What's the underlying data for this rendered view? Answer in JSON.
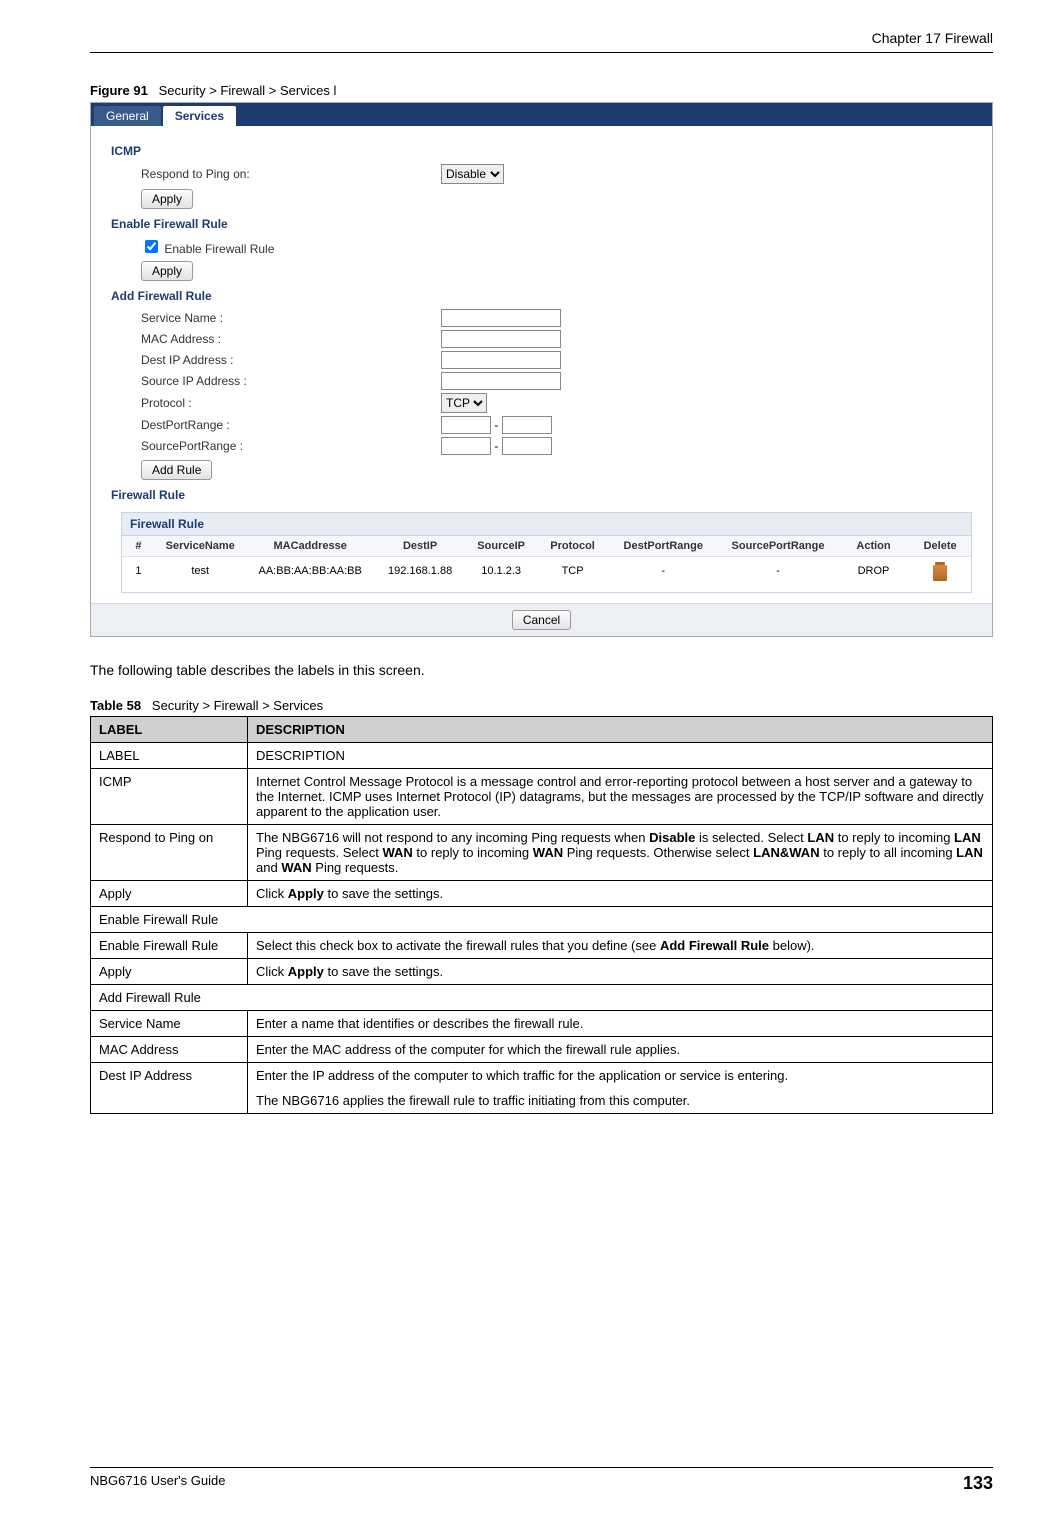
{
  "header": {
    "chapter": "Chapter 17 Firewall"
  },
  "figure": {
    "num": "Figure 91",
    "caption": "Security > Firewall > Services l"
  },
  "tabs": {
    "general": "General",
    "services": "Services"
  },
  "sections": {
    "icmp": "ICMP",
    "respond_label": "Respond to Ping on:",
    "respond_value": "Disable",
    "apply": "Apply",
    "enable_fw_rule": "Enable Firewall Rule",
    "enable_fw_rule_cb": "Enable Firewall Rule",
    "add_fw_rule": "Add Firewall Rule",
    "service_name": "Service Name :",
    "mac_address": "MAC Address :",
    "dest_ip": "Dest IP Address :",
    "source_ip": "Source IP Address :",
    "protocol": "Protocol :",
    "protocol_value": "TCP",
    "dest_port": "DestPortRange :",
    "src_port": "SourcePortRange :",
    "add_rule_btn": "Add Rule",
    "firewall_rule": "Firewall Rule",
    "fr_box_title": "Firewall Rule",
    "cancel": "Cancel"
  },
  "fr_headers": [
    "#",
    "ServiceName",
    "MACaddresse",
    "DestIP",
    "SourceIP",
    "Protocol",
    "DestPortRange",
    "SourcePortRange",
    "Action",
    "Delete"
  ],
  "fr_row": [
    "1",
    "test",
    "AA:BB:AA:BB:AA:BB",
    "192.168.1.88",
    "10.1.2.3",
    "TCP",
    "-",
    "-",
    "DROP",
    ""
  ],
  "intro": "The following table describes the labels in this screen.",
  "table_caption": {
    "num": "Table 58",
    "title": "Security > Firewall > Services"
  },
  "desc_headers": {
    "label": "LABEL",
    "desc": "DESCRIPTION"
  },
  "desc_rows": [
    {
      "label": "LABEL",
      "desc": "DESCRIPTION"
    },
    {
      "label": "ICMP",
      "desc": "Internet Control Message Protocol is a message control and error-reporting protocol between a host server and a gateway to the Internet. ICMP uses Internet Protocol (IP) datagrams, but the messages are processed by the TCP/IP software and directly apparent to the application user."
    },
    {
      "label": "Respond to Ping on",
      "desc": "The NBG6716 will not respond to any incoming Ping requests when Disable is selected. Select LAN to reply to incoming LAN Ping requests. Select WAN to reply to incoming WAN Ping requests. Otherwise select LAN&WAN to reply to all incoming LAN and WAN Ping requests."
    },
    {
      "label": "Apply",
      "desc": "Click Apply to save the settings."
    },
    {
      "label": "Enable Firewall Rule",
      "desc": "",
      "section": true
    },
    {
      "label": "Enable Firewall Rule",
      "desc": "Select this check box to activate the firewall rules that you define (see Add Firewall Rule below)."
    },
    {
      "label": "Apply",
      "desc": "Click Apply to save the settings."
    },
    {
      "label": "Add Firewall Rule",
      "desc": "",
      "section": true
    },
    {
      "label": "Service Name",
      "desc": "Enter a name that identifies or describes the firewall rule."
    },
    {
      "label": "MAC Address",
      "desc": "Enter the MAC address of the computer for which the firewall rule applies."
    },
    {
      "label": "Dest IP Address",
      "desc": "Enter the IP address of the computer to which traffic for the application or service is entering.\n\nThe NBG6716 applies the firewall rule to traffic initiating from this computer."
    }
  ],
  "footer": {
    "guide": "NBG6716 User's Guide",
    "page": "133"
  }
}
